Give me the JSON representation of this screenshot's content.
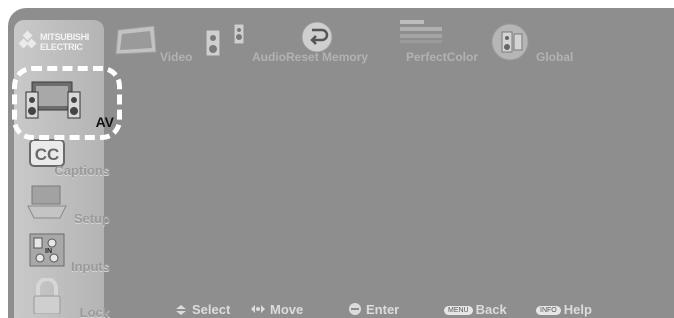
{
  "brand": "MITSUBISHI ELECTRIC",
  "top_menu": [
    {
      "label": "Video",
      "icon": "tv-icon"
    },
    {
      "label": "Audio",
      "icon": "speakers-icon"
    },
    {
      "label": "Reset Memory",
      "icon": "reset-icon"
    },
    {
      "label": "PerfectColor",
      "icon": "color-bars-icon"
    },
    {
      "label": "Global",
      "icon": "globe-icon"
    }
  ],
  "side_menu": [
    {
      "label": "AV",
      "icon": "av-icon",
      "selected": true
    },
    {
      "label": "Captions",
      "icon": "cc-icon"
    },
    {
      "label": "Setup",
      "icon": "setup-tv-icon"
    },
    {
      "label": "Inputs",
      "icon": "inputs-icon"
    },
    {
      "label": "Lock",
      "icon": "lock-icon"
    }
  ],
  "hints": {
    "select": "Select",
    "move": "Move",
    "enter": "Enter",
    "back_key": "MENU",
    "back": "Back",
    "help_key": "INFO",
    "help": "Help"
  }
}
